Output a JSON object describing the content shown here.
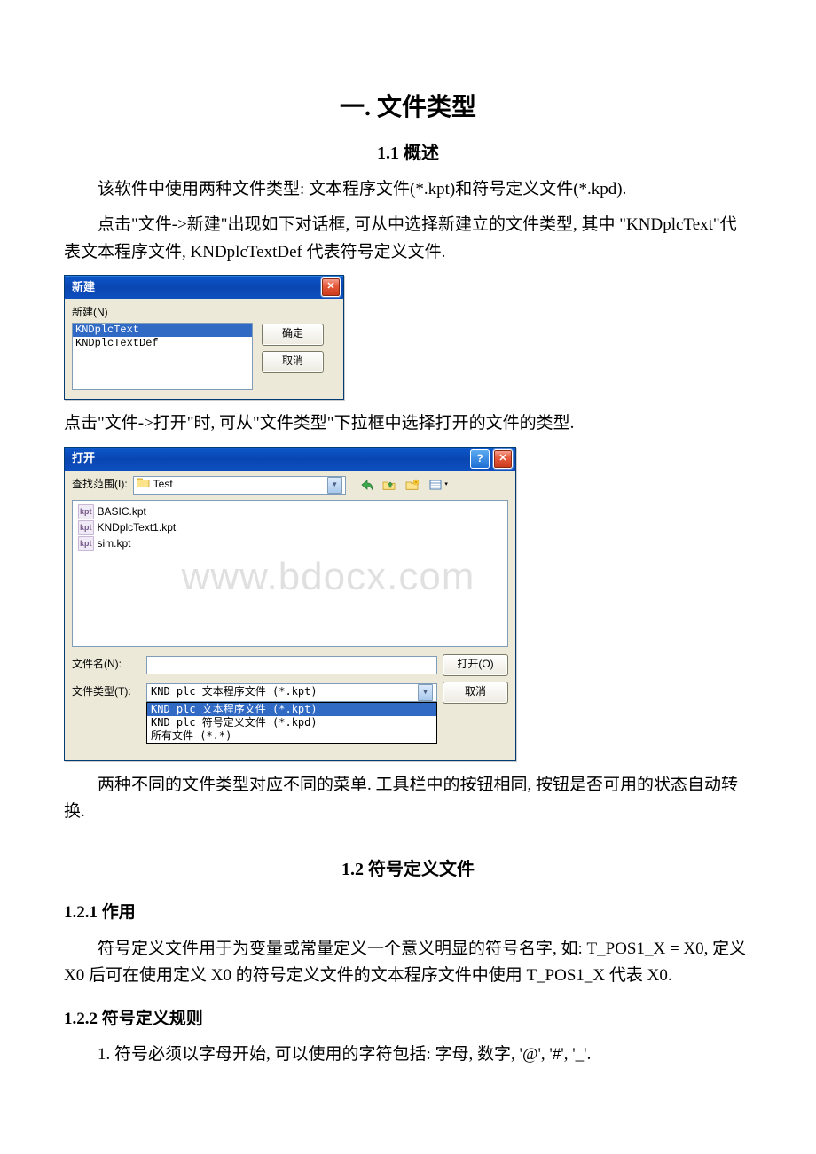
{
  "headings": {
    "title": "一. 文件类型",
    "sec11": "1.1 概述",
    "sec12": "1.2 符号定义文件",
    "sec121": "1.2.1 作用",
    "sec122": "1.2.2 符号定义规则"
  },
  "paragraphs": {
    "p1": "该软件中使用两种文件类型: 文本程序文件(*.kpt)和符号定义文件(*.kpd).",
    "p2": "点击\"文件->新建\"出现如下对话框, 可从中选择新建立的文件类型, 其中 \"KNDplcText\"代表文本程序文件, KNDplcTextDef 代表符号定义文件.",
    "p3": "点击\"文件->打开\"时, 可从\"文件类型\"下拉框中选择打开的文件的类型.",
    "p4": "两种不同的文件类型对应不同的菜单. 工具栏中的按钮相同, 按钮是否可用的状态自动转换.",
    "p5": "符号定义文件用于为变量或常量定义一个意义明显的符号名字, 如: T_POS1_X = X0, 定义 X0 后可在使用定义 X0 的符号定义文件的文本程序文件中使用 T_POS1_X 代表 X0.",
    "p6": "1. 符号必须以字母开始, 可以使用的字符包括: 字母, 数字, '@', '#', '_'."
  },
  "dialog_new": {
    "title": "新建",
    "label": "新建(N)",
    "items": [
      "KNDplcText",
      "KNDplcTextDef"
    ],
    "ok": "确定",
    "cancel": "取消"
  },
  "dialog_open": {
    "title": "打开",
    "lookin_label": "查找范围(I):",
    "folder": "Test",
    "files": [
      "BASIC.kpt",
      "KNDplcText1.kpt",
      "sim.kpt"
    ],
    "filename_label": "文件名(N):",
    "filename_value": "",
    "filetype_label": "文件类型(T):",
    "filetype_selected": "KND plc 文本程序文件 (*.kpt)",
    "filetype_options": [
      "KND plc 文本程序文件 (*.kpt)",
      "KND plc 符号定义文件 (*.kpd)",
      "所有文件 (*.*)"
    ],
    "open_btn": "打开(O)",
    "cancel_btn": "取消"
  },
  "watermark": "www.bdocx.com",
  "glyphs": {
    "close_x": "✕",
    "help_q": "?",
    "arrow_down": "▼",
    "back": "⇦",
    "dot_menu": "▾"
  }
}
